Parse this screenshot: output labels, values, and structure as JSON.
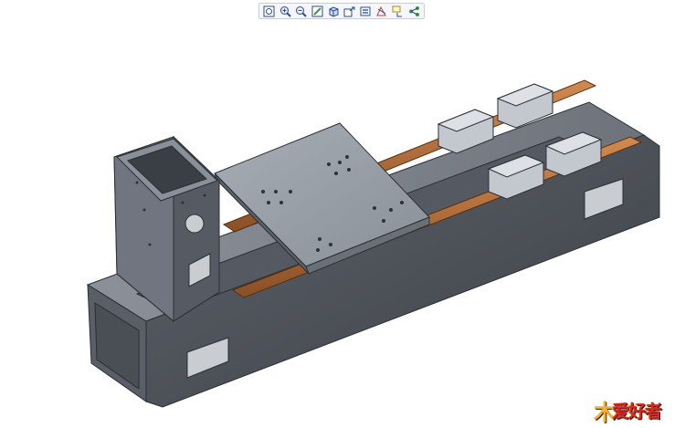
{
  "toolbar": {
    "tools": [
      {
        "name": "refit-icon"
      },
      {
        "name": "zoom-in-icon"
      },
      {
        "name": "zoom-out-icon"
      },
      {
        "name": "repaint-icon"
      },
      {
        "name": "display-style-icon"
      },
      {
        "name": "saved-views-icon"
      },
      {
        "name": "layers-icon"
      },
      {
        "name": "datum-display-icon"
      },
      {
        "name": "annotation-display-icon"
      },
      {
        "name": "spin-center-icon"
      }
    ]
  },
  "colors": {
    "frame_front": "#4c5058",
    "frame_top": "#7d838c",
    "rail": "#b8703a",
    "carriage": "#c3c8cf",
    "plate_top": "#9aa0a8",
    "toolbar_bg": "#f4f6f9"
  },
  "watermark": {
    "mark": "木",
    "text": "爱好者"
  }
}
